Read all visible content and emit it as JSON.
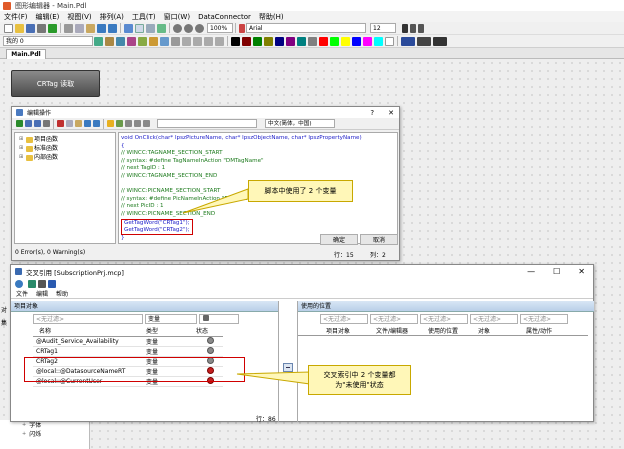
{
  "app": {
    "title": "图形编辑器 - Main.Pdl",
    "menus": [
      "文件(F)",
      "编辑(E)",
      "视图(V)",
      "排列(A)",
      "工具(T)",
      "窗口(W)",
      "DataConnector",
      "帮助(H)"
    ],
    "zoom": "100%",
    "font_name": "Arial",
    "font_size": "12",
    "layer": "我的 0",
    "doc_tab": "Main.Pdl",
    "canvas_button": "CRTag 读取"
  },
  "editor": {
    "title": "编辑操作",
    "lang": "中文(简体，中国)",
    "tree": [
      "项目函数",
      "标准函数",
      "内部函数"
    ],
    "code": [
      "void OnClick(char* lpszPictureName, char* lpszObjectName, char* lpszPropertyName)",
      "{",
      "// WINCC:TAGNAME_SECTION_START",
      "// syntax: #define TagNameInAction \"DMTagName\"",
      "// next TagID : 1",
      "// WINCC:TAGNAME_SECTION_END",
      "",
      "// WINCC:PICNAME_SECTION_START",
      "// syntax: #define PicNameInAction \"PictureName\"",
      "// next PicID : 1",
      "// WINCC:PICNAME_SECTION_END",
      "GetTagWord(\"CRTag1\");",
      "GetTagWord(\"CRTag2\");",
      "}"
    ],
    "status": "0 Error(s), 0 Warning(s)",
    "ok": "确定",
    "cancel": "取消",
    "row_label": "行：15",
    "col_label": "列：2"
  },
  "callout1": "脚本中使用了 2 个变量",
  "xref": {
    "title": "交叉引用 [SubscriptionPrj.mcp]",
    "menus": [
      "文件",
      "编辑",
      "帮助"
    ],
    "left_header": "项目对象",
    "right_header": "使用的位置",
    "filter": "<无过滤>",
    "filter_type": "变量",
    "cols": [
      "名称",
      "类型",
      "状态"
    ],
    "rows": [
      {
        "name": "@Audit_Service_Availability",
        "type": "变量",
        "status": "gray"
      },
      {
        "name": "CRTag1",
        "type": "变量",
        "status": "gray"
      },
      {
        "name": "CRTag2",
        "type": "变量",
        "status": "gray"
      },
      {
        "name": "@local::@DatasourceNameRT",
        "type": "变量",
        "status": "red"
      },
      {
        "name": "@local::@CurrentUser",
        "type": "变量",
        "status": "red"
      }
    ],
    "right_cols": [
      "项目对象",
      "文件/编辑器",
      "使用的位置",
      "对象",
      "属性/动作"
    ],
    "row_count": "行：86"
  },
  "callout2": "交叉索引中 2 个变量都为\"未使用\"状态",
  "bg": {
    "side_a": "对",
    "side_b": "集",
    "tree": [
      "字体",
      "闪烁"
    ]
  },
  "colors": {
    "accent": "#c00000",
    "callout": "#fff7b8"
  }
}
